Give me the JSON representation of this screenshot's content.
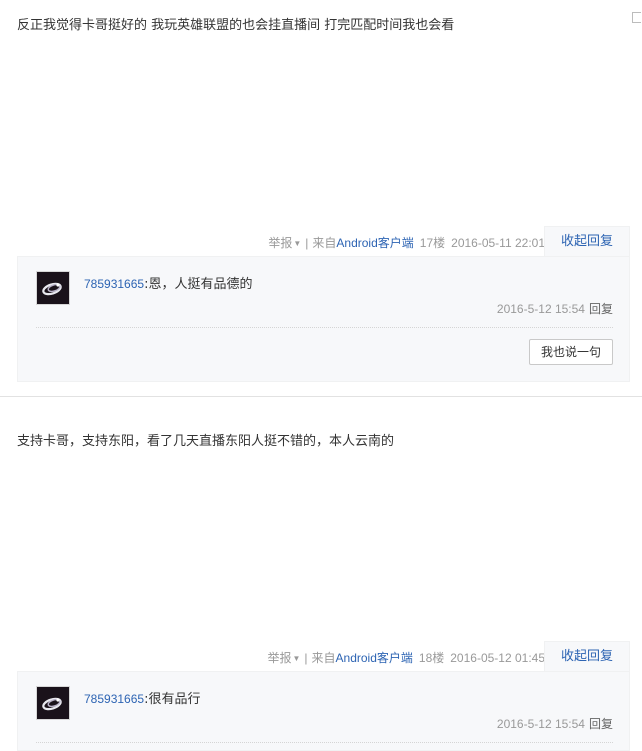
{
  "posts": [
    {
      "content": "反正我觉得卡哥挺好的 我玩英雄联盟的也会挂直播间 打完匹配时间我也会看",
      "tail": {
        "report": "举报",
        "separator": "|",
        "from_prefix": "来自",
        "client": "Android客户端",
        "floor": "17楼",
        "date": "2016-05-11 22:01"
      },
      "collapse_label": "收起回复",
      "replies": [
        {
          "user": "785931665",
          "colon": ":",
          "text": "恩，人挺有品德的",
          "time": "2016-5-12 15:54",
          "reply_label": "回复"
        }
      ],
      "say_button": "我也说一句"
    },
    {
      "content": "支持卡哥，支持东阳，看了几天直播东阳人挺不错的，本人云南的",
      "tail": {
        "report": "举报",
        "separator": "|",
        "from_prefix": "来自",
        "client": "Android客户端",
        "floor": "18楼",
        "date": "2016-05-12 01:45"
      },
      "collapse_label": "收起回复",
      "replies": [
        {
          "user": "785931665",
          "colon": ":",
          "text": "很有品行",
          "time": "2016-5-12 15:54",
          "reply_label": "回复"
        }
      ]
    }
  ],
  "colors": {
    "link": "#2d64b3",
    "meta": "#999999",
    "reply_bg": "#f7f8fa"
  }
}
